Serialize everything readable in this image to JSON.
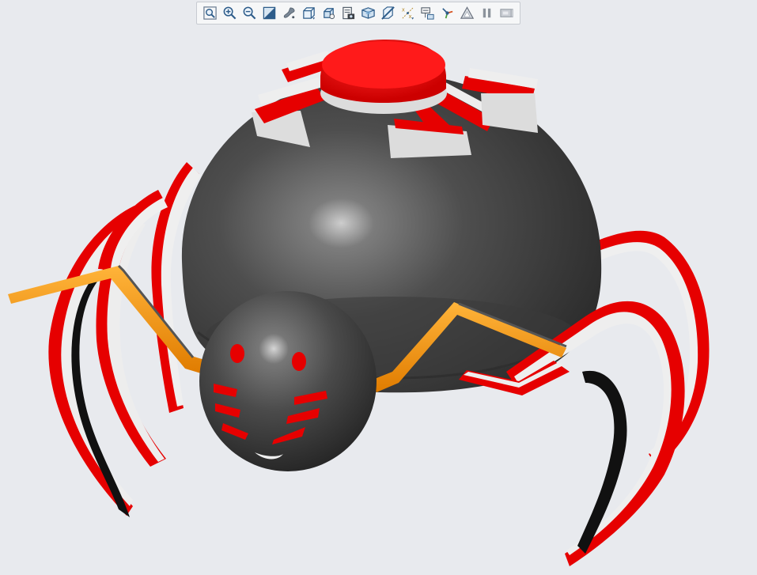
{
  "viewer": {
    "background": "#e8eaee"
  },
  "toolbar": {
    "tools": [
      {
        "name": "refit-icon",
        "label": ""
      },
      {
        "name": "zoom-in-icon",
        "label": ""
      },
      {
        "name": "zoom-out-icon",
        "label": ""
      },
      {
        "name": "display-style-icon",
        "label": ""
      },
      {
        "name": "appearance-icon",
        "label": ""
      },
      {
        "name": "standard-view-icon",
        "label": ""
      },
      {
        "name": "view-manager-icon",
        "label": ""
      },
      {
        "name": "saved-views-icon",
        "label": ""
      },
      {
        "name": "perspective-icon",
        "label": ""
      },
      {
        "name": "section-icon",
        "label": ""
      },
      {
        "name": "datum-display-icon",
        "label": ""
      },
      {
        "name": "annotation-display-icon",
        "label": ""
      },
      {
        "name": "spin-center-icon",
        "label": ""
      },
      {
        "name": "render-icon",
        "label": ""
      },
      {
        "name": "pause-icon",
        "label": ""
      },
      {
        "name": "dynamic-view-icon",
        "label": ""
      }
    ]
  },
  "model": {
    "name": "",
    "colors": {
      "body": "#4a4a4a",
      "accent_red": "#e30000",
      "accent_white": "#eeeeee",
      "fang_orange": "#f59a18"
    }
  }
}
